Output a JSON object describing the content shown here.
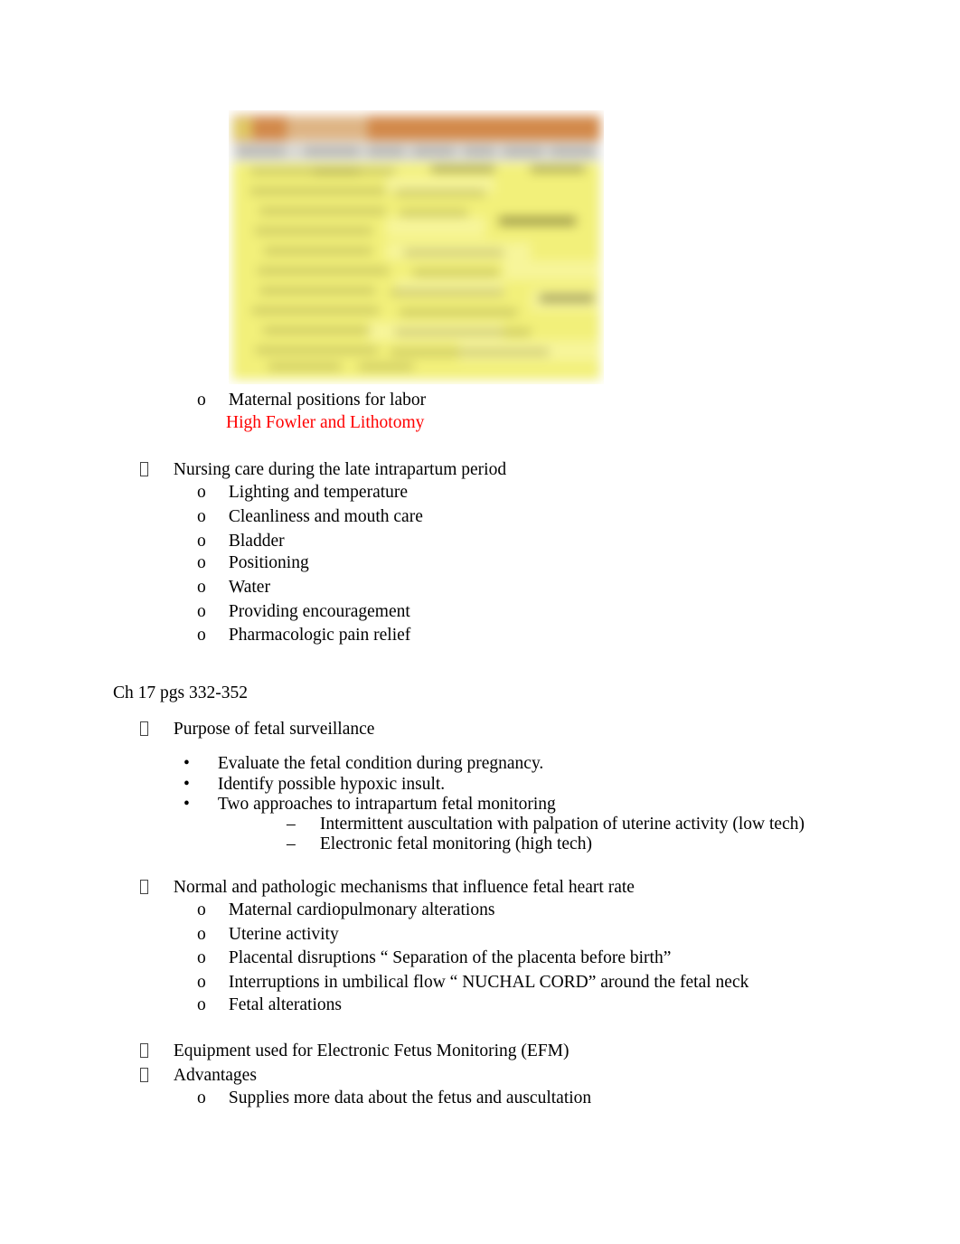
{
  "document": {
    "type": "study-guide-outline",
    "colors": {
      "body_text": "#000000",
      "answer_text": "#ff0000",
      "figure_header_bar": "#d2894a",
      "figure_subtitle_bar": "#d8d8d4",
      "figure_highlight": "#f2f07a"
    }
  },
  "figure": {
    "caption": "",
    "description": "blurred embedded screenshot of a slide: orange title bar, grey subtitle band, yellow-highlighted text body"
  },
  "outline": {
    "maternal_positions": {
      "bullet": "o",
      "label": "Maternal positions for labor",
      "answer": "High Fowler and Lithotomy"
    },
    "late_intrapartum": {
      "bullet": "box",
      "heading": "Nursing care during the late intrapartum period",
      "items": [
        "Lighting and temperature",
        "Cleanliness and mouth care",
        "Bladder",
        "Positioning",
        "Water",
        "Providing encouragement",
        "Pharmacologic pain relief"
      ]
    },
    "chapter_heading": "Ch 17 pgs 332-352",
    "fetal_surveillance": {
      "bullet": "box",
      "heading": "Purpose of fetal surveillance",
      "items": [
        "Evaluate the fetal condition during pregnancy.",
        "Identify possible hypoxic insult.",
        "Two approaches to intrapartum fetal monitoring"
      ],
      "subitems": [
        "Intermittent auscultation with palpation of uterine activity (low tech)",
        "Electronic fetal monitoring (high tech)"
      ]
    },
    "fhr_mechanisms": {
      "bullet": "box",
      "heading": "Normal and pathologic mechanisms that influence fetal heart rate",
      "items": [
        "Maternal cardiopulmonary alterations",
        "Uterine activity",
        "Placental disruptions “ Separation of the placenta before birth”",
        "Interruptions in umbilical flow “ NUCHAL CORD” around the fetal neck",
        "Fetal alterations"
      ]
    },
    "efm_equipment": {
      "bullet": "box",
      "heading": "Equipment used for Electronic Fetus Monitoring (EFM)"
    },
    "advantages": {
      "bullet": "box",
      "heading": "Advantages",
      "items": [
        "Supplies more data about the fetus and auscultation"
      ]
    }
  },
  "glyphs": {
    "circle_bullet": "o",
    "round_bullet": "•",
    "dash_bullet": "–"
  }
}
